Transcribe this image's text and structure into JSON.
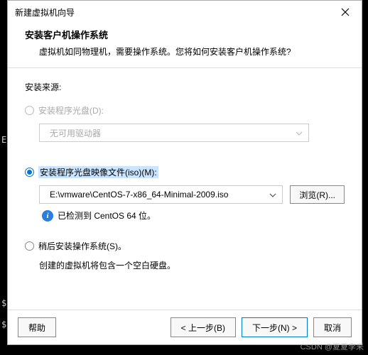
{
  "titlebar": {
    "title": "新建虚拟机向导"
  },
  "header": {
    "title": "安装客户机操作系统",
    "desc": "虚拟机如同物理机，需要操作系统。您将如何安装客户机操作系统?"
  },
  "source_label": "安装来源:",
  "option_disc": {
    "label": "安装程序光盘(D):",
    "combo": "无可用驱动器"
  },
  "option_iso": {
    "label": "安装程序光盘映像文件(iso)(M):",
    "path": "E:\\vmware\\CentOS-7-x86_64-Minimal-2009.iso",
    "browse": "浏览(R)...",
    "detected": "已检测到 CentOS 64 位。"
  },
  "option_later": {
    "label": "稍后安装操作系统(S)。",
    "desc": "创建的虚拟机将包含一个空白硬盘。"
  },
  "footer": {
    "help": "帮助",
    "back": "< 上一步(B)",
    "next": "下一步(N) >",
    "cancel": "取消"
  },
  "watermark": "CSDN @夏夏李来",
  "info_glyph": "i"
}
